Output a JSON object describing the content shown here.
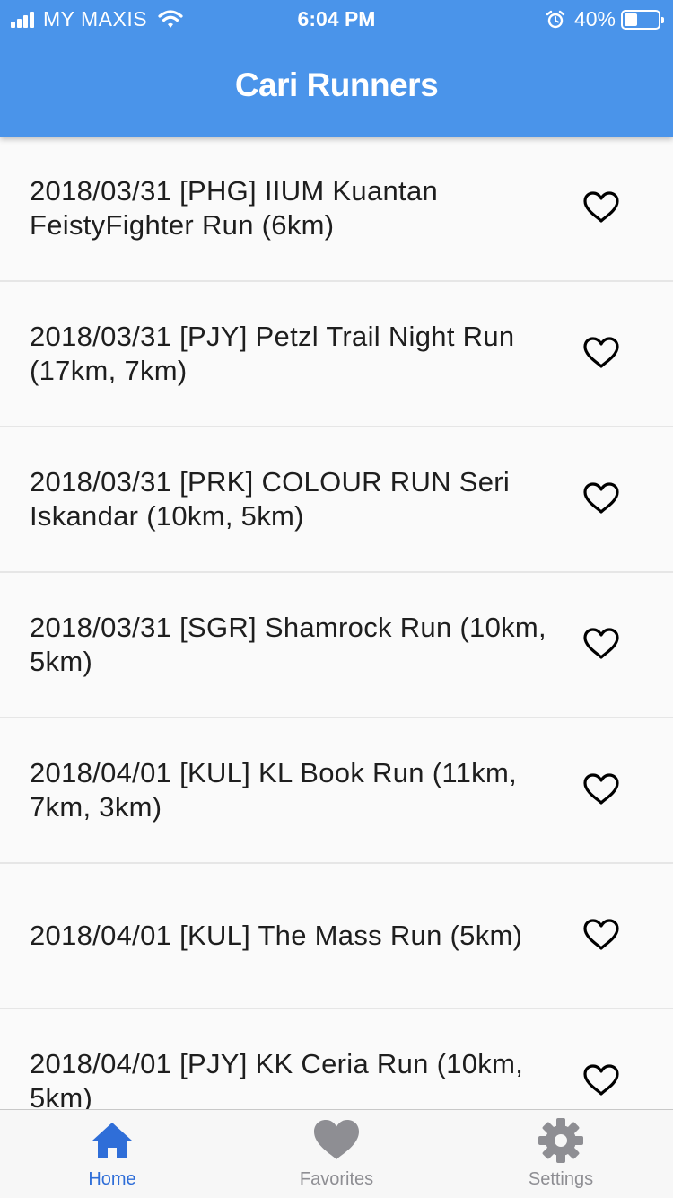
{
  "status_bar": {
    "carrier": "MY MAXIS",
    "time": "6:04 PM",
    "battery_percent": "40%",
    "battery_level": 0.4
  },
  "header": {
    "title": "Cari Runners"
  },
  "events": [
    {
      "title": "2018/03/31 [PHG] IIUM Kuantan FeistyFighter Run (6km)",
      "icon": "heart-outline-icon"
    },
    {
      "title": "2018/03/31 [PJY] Petzl Trail Night Run (17km, 7km)",
      "icon": "heart-outline-icon"
    },
    {
      "title": "2018/03/31 [PRK] COLOUR RUN Seri Iskandar (10km, 5km)",
      "icon": "heart-outline-icon"
    },
    {
      "title": "2018/03/31 [SGR] Shamrock Run (10km, 5km)",
      "icon": "heart-outline-icon"
    },
    {
      "title": "2018/04/01 [KUL] KL Book Run (11km, 7km, 3km)",
      "icon": "heart-outline-icon"
    },
    {
      "title": "2018/04/01 [KUL] The Mass Run (5km)",
      "icon": "heart-outline-icon"
    },
    {
      "title": "2018/04/01 [PJY] KK Ceria Run (10km, 5km)",
      "icon": "heart-outline-icon"
    }
  ],
  "tabs": [
    {
      "label": "Home",
      "icon": "home-icon",
      "active": true
    },
    {
      "label": "Favorites",
      "icon": "heart-filled-icon",
      "active": false
    },
    {
      "label": "Settings",
      "icon": "gear-icon",
      "active": false
    }
  ],
  "colors": {
    "header_bg": "#4a94ea",
    "tab_active": "#2f6ed8",
    "tab_inactive": "#8e8e93"
  }
}
